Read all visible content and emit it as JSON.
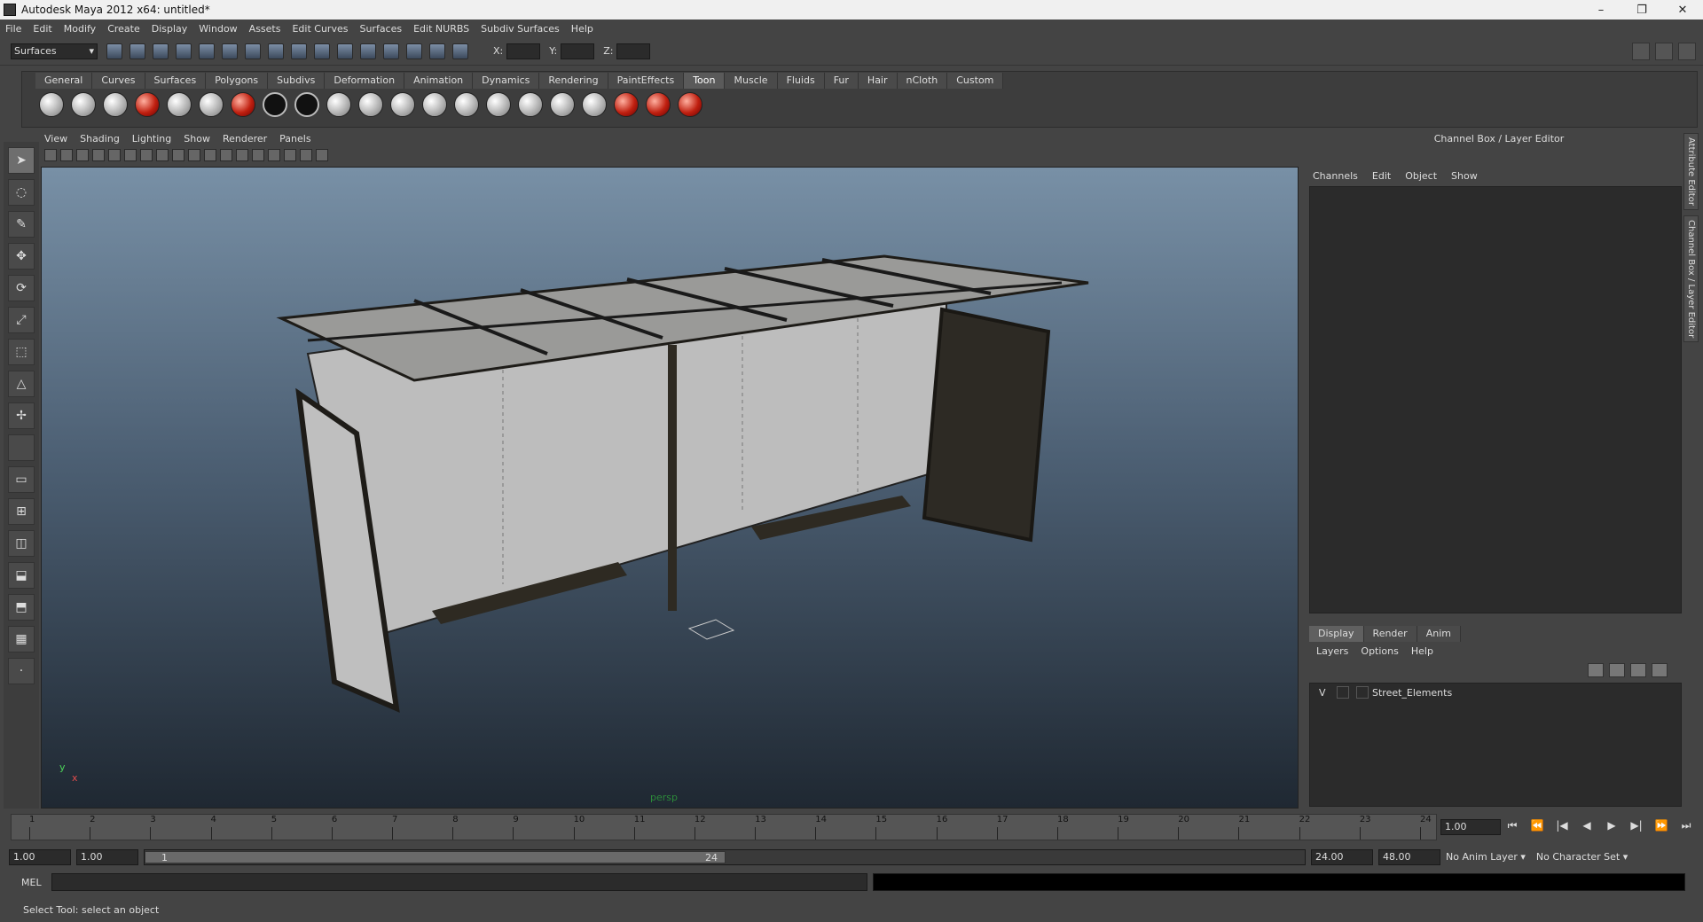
{
  "window": {
    "title": "Autodesk Maya 2012 x64: untitled*",
    "min": "–",
    "max": "❐",
    "close": "✕"
  },
  "menu": [
    "File",
    "Edit",
    "Modify",
    "Create",
    "Display",
    "Window",
    "Assets",
    "Edit Curves",
    "Surfaces",
    "Edit NURBS",
    "Subdiv Surfaces",
    "Help"
  ],
  "status_line": {
    "menu_set": "Surfaces",
    "x_label": "X:",
    "y_label": "Y:",
    "z_label": "Z:"
  },
  "shelf": {
    "tabs": [
      "General",
      "Curves",
      "Surfaces",
      "Polygons",
      "Subdivs",
      "Deformation",
      "Animation",
      "Dynamics",
      "Rendering",
      "PaintEffects",
      "Toon",
      "Muscle",
      "Fluids",
      "Fur",
      "Hair",
      "nCloth",
      "Custom"
    ],
    "active_tab": "Toon"
  },
  "panel": {
    "menu": [
      "View",
      "Shading",
      "Lighting",
      "Show",
      "Renderer",
      "Panels"
    ],
    "camera_label": "persp",
    "axis_y": "y",
    "axis_x": "x"
  },
  "channel_box": {
    "header": "Channel Box / Layer Editor",
    "menu": [
      "Channels",
      "Edit",
      "Object",
      "Show"
    ],
    "side_tabs": [
      "Attribute Editor",
      "Channel Box / Layer Editor"
    ]
  },
  "layer_editor": {
    "tabs": [
      "Display",
      "Render",
      "Anim"
    ],
    "active_tab": "Display",
    "menu": [
      "Layers",
      "Options",
      "Help"
    ],
    "layers": [
      {
        "visible": "V",
        "name": "Street_Elements"
      }
    ]
  },
  "time_slider": {
    "ticks": [
      "1",
      "2",
      "3",
      "4",
      "5",
      "6",
      "7",
      "8",
      "9",
      "10",
      "11",
      "12",
      "13",
      "14",
      "15",
      "16",
      "17",
      "18",
      "19",
      "20",
      "21",
      "22",
      "23",
      "24"
    ],
    "current_frame": "1.00",
    "current_marker": "1"
  },
  "playback": [
    "⏮",
    "⏪",
    "|◀",
    "◀",
    "▶",
    "▶|",
    "⏩",
    "⏭"
  ],
  "range": {
    "start": "1.00",
    "playback_start": "1.00",
    "handle_start": "1",
    "handle_end": "24",
    "playback_end": "24.00",
    "end": "48.00",
    "anim_layer": "No Anim Layer",
    "character_set": "No Character Set"
  },
  "command_line": {
    "language": "MEL"
  },
  "help_line": "Select Tool: select an object"
}
